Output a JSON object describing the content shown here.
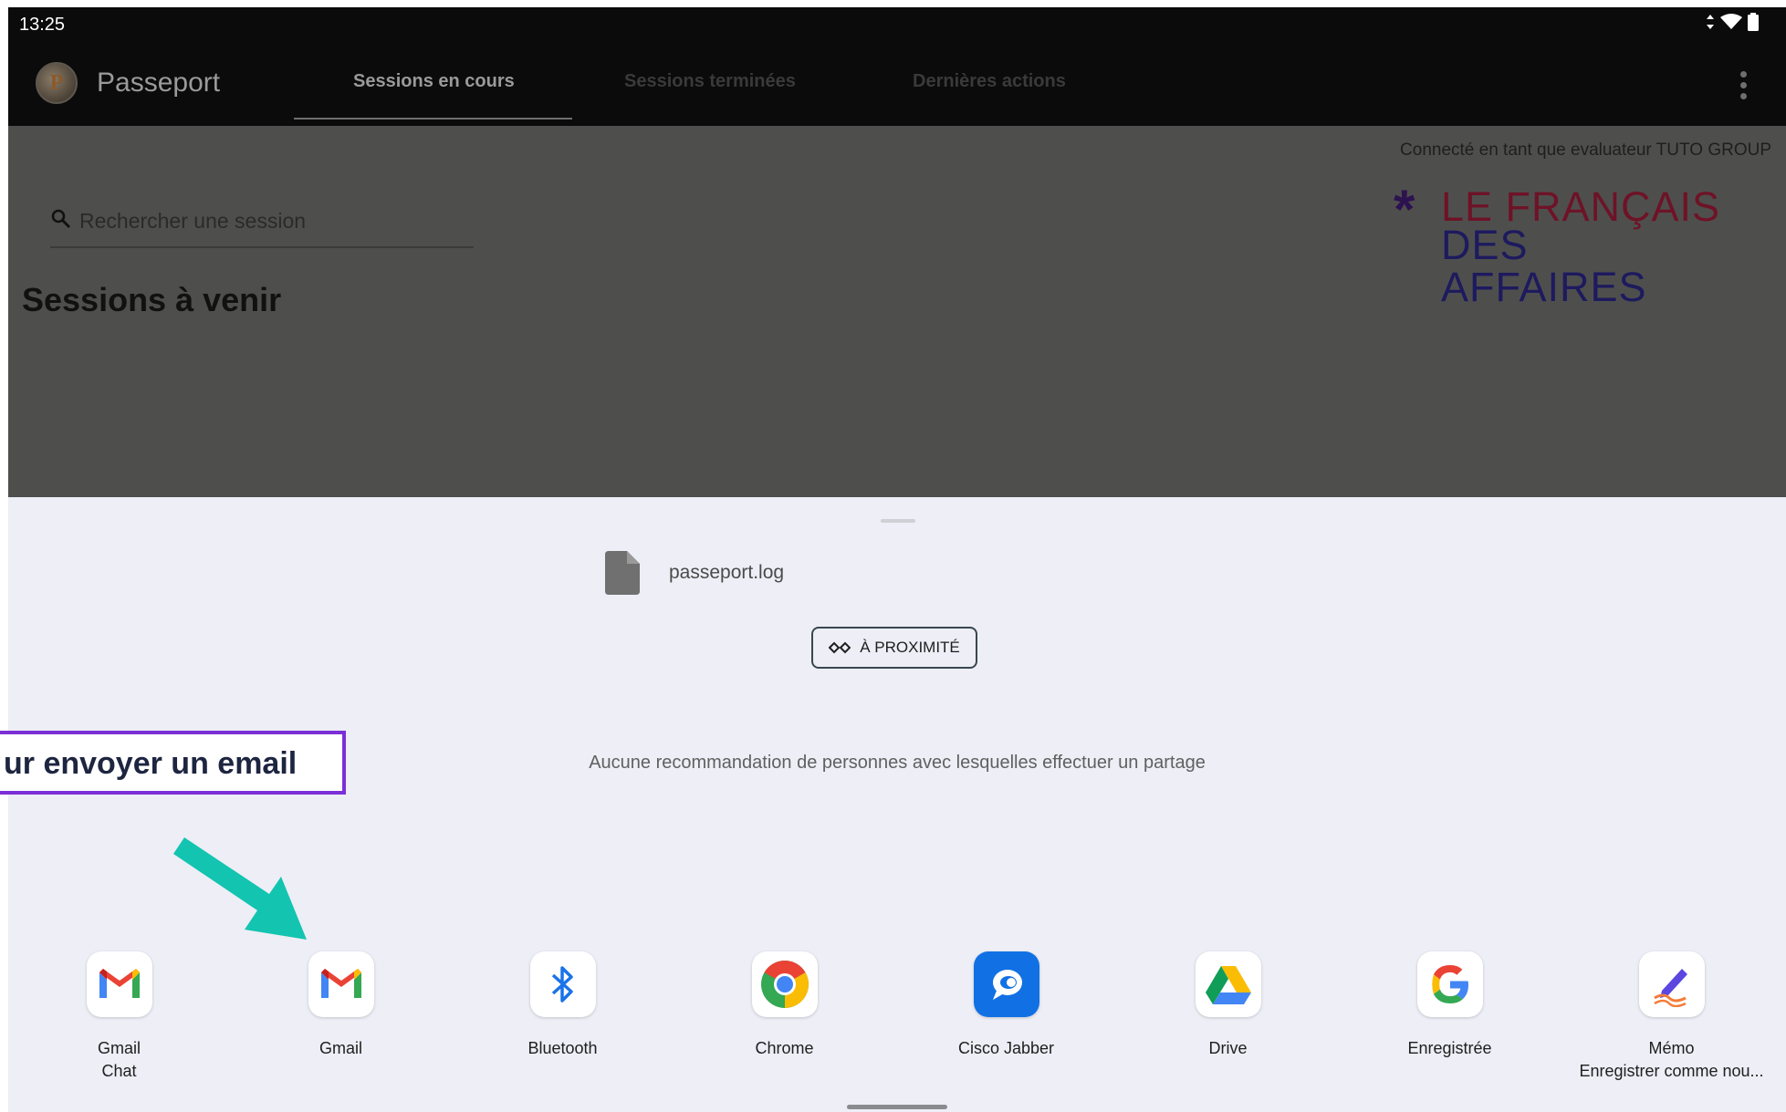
{
  "status_bar": {
    "time": "13:25"
  },
  "app_bar": {
    "title": "Passeport",
    "logo_letter": "P",
    "tabs": [
      {
        "label": "Sessions en cours",
        "active": true
      },
      {
        "label": "Sessions terminées",
        "active": false
      },
      {
        "label": "Dernières actions",
        "active": false
      }
    ]
  },
  "content": {
    "connected_as": "Connecté en tant que evaluateur TUTO GROUP",
    "brand": {
      "star": "*",
      "line1": "LE FRANÇAIS",
      "line2": "DES AFFAIRES"
    },
    "search": {
      "placeholder": "Rechercher une session",
      "value": ""
    },
    "section_title": "Sessions à venir"
  },
  "share_sheet": {
    "file_name": "passeport.log",
    "nearby_label": "À PROXIMITÉ",
    "no_recommendation": "Aucune recommandation de personnes avec lesquelles effectuer un partage",
    "apps": [
      {
        "name": "Gmail",
        "subtitle": "Chat",
        "icon": "gmail-icon"
      },
      {
        "name": "Gmail",
        "subtitle": "",
        "icon": "gmail-icon"
      },
      {
        "name": "Bluetooth",
        "subtitle": "",
        "icon": "bluetooth-icon"
      },
      {
        "name": "Chrome",
        "subtitle": "",
        "icon": "chrome-icon"
      },
      {
        "name": "Cisco Jabber",
        "subtitle": "",
        "icon": "cisco-jabber-icon"
      },
      {
        "name": "Drive",
        "subtitle": "",
        "icon": "drive-icon"
      },
      {
        "name": "Enregistrée",
        "subtitle": "",
        "icon": "google-icon"
      },
      {
        "name": "Mémo",
        "subtitle": "Enregistrer comme nou...",
        "icon": "memo-icon"
      }
    ]
  },
  "tutorial": {
    "callout_text": "ur envoyer un email"
  },
  "colors": {
    "appbar_bg": "#0b0b0b",
    "dim_overlay": "#4e4f4d",
    "sheet_bg": "#edeef6",
    "callout_border": "#7b2fd6",
    "arrow": "#13c4b0",
    "brand_red": "#6e1327",
    "brand_blue": "#1e1a5e"
  }
}
